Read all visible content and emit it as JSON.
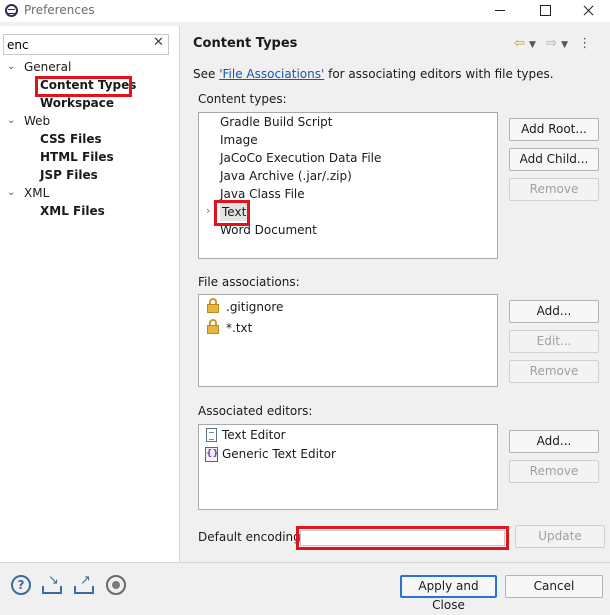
{
  "window": {
    "title": "Preferences"
  },
  "filter": {
    "value": "enc"
  },
  "tree": {
    "categories": [
      {
        "label": "General",
        "expanded": true,
        "children": [
          "Content Types",
          "Workspace"
        ]
      },
      {
        "label": "Web",
        "expanded": true,
        "children": [
          "CSS Files",
          "HTML Files",
          "JSP Files"
        ]
      },
      {
        "label": "XML",
        "expanded": true,
        "children": [
          "XML Files"
        ]
      }
    ],
    "selected": "Content Types"
  },
  "page": {
    "title": "Content Types",
    "description_prefix": "See ",
    "description_link": "'File Associations'",
    "description_suffix": " for associating editors with file types."
  },
  "content_types": {
    "label": "Content types:",
    "items": [
      "Gradle Build Script",
      "Image",
      "JaCoCo Execution Data File",
      "Java Archive (.jar/.zip)",
      "Java Class File",
      "Text",
      "Word Document"
    ],
    "selected": "Text",
    "buttons": {
      "add_root": "Add Root...",
      "add_child": "Add Child...",
      "remove": "Remove"
    }
  },
  "file_associations": {
    "label": "File associations:",
    "items": [
      ".gitignore",
      "*.txt"
    ],
    "buttons": {
      "add": "Add...",
      "edit": "Edit...",
      "remove": "Remove"
    }
  },
  "associated_editors": {
    "label": "Associated editors:",
    "items": [
      "Text Editor",
      "Generic Text Editor"
    ],
    "buttons": {
      "add": "Add...",
      "remove": "Remove"
    }
  },
  "encoding": {
    "label": "Default encoding:",
    "value": "",
    "update_label": "Update"
  },
  "footer": {
    "apply_close": "Apply and Close",
    "cancel": "Cancel"
  },
  "icons": {
    "app": "eclipse-icon",
    "help": "help-icon",
    "import": "import-icon",
    "export": "export-icon",
    "record": "record-icon",
    "lock": "lock-icon",
    "text_editor": "document-icon",
    "generic_editor": "generic-editor-icon",
    "back": "arrow-left-icon",
    "forward": "arrow-right-icon"
  },
  "colors": {
    "highlight": "#e0141e",
    "link": "#1a55b0",
    "primary_button_border": "#2b72d7"
  }
}
